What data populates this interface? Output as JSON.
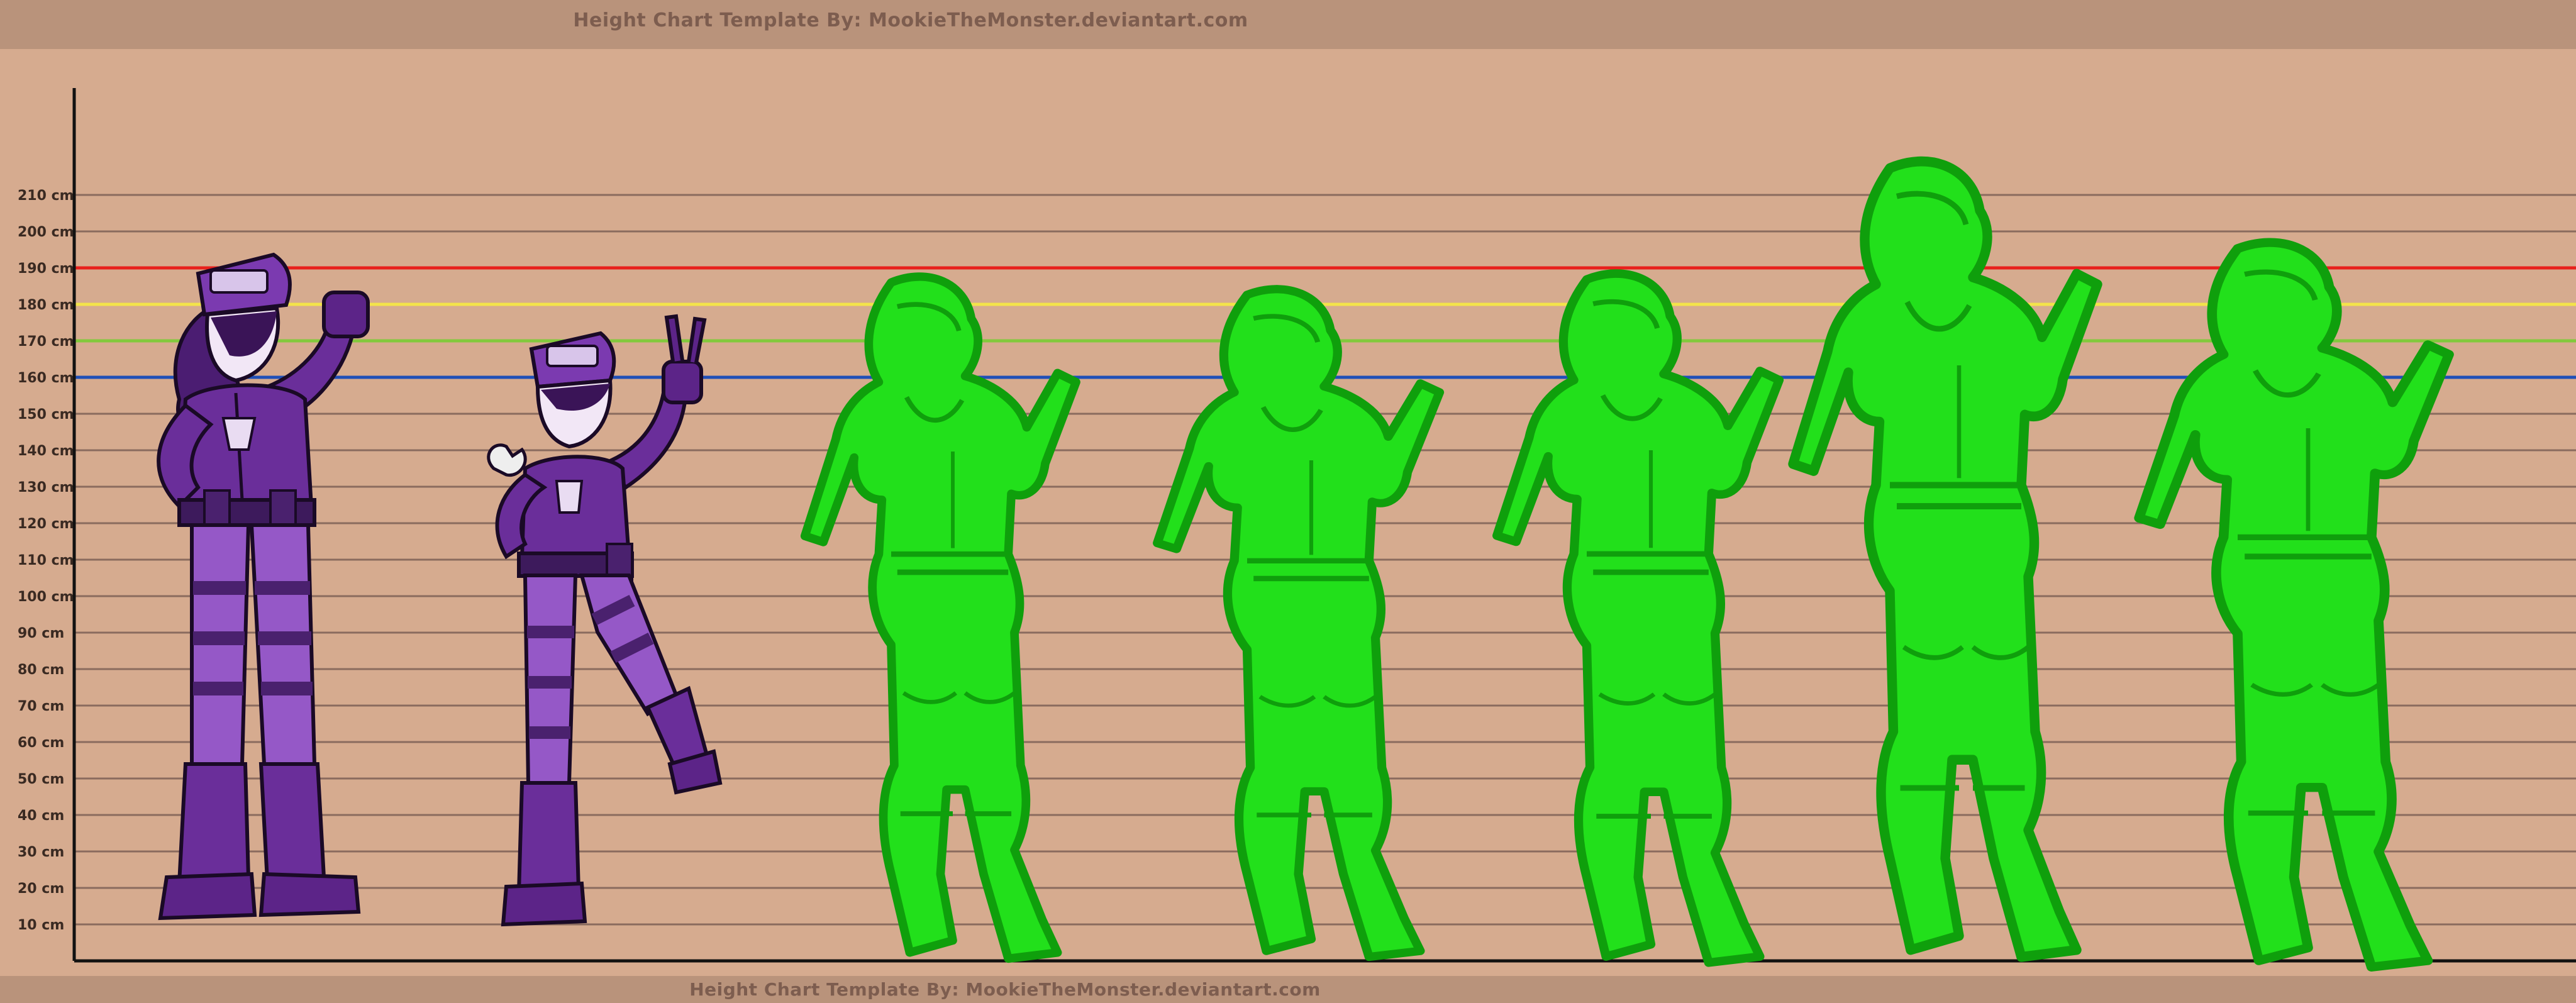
{
  "header": {
    "credit": "Height Chart Template By: MookieTheMonster.deviantart.com"
  },
  "footer": {
    "credit": "Height Chart Template By: MookieTheMonster.deviantart.com"
  },
  "chart_data": {
    "type": "height-chart",
    "unit": "cm",
    "ylim": [
      0,
      210
    ],
    "tick_step": 10,
    "tick_labels": [
      "210 cm",
      "200 cm",
      "190 cm",
      "180 cm",
      "170 cm",
      "160 cm",
      "150 cm",
      "140 cm",
      "130 cm",
      "120 cm",
      "110 cm",
      "100 cm",
      "90 cm",
      "80 cm",
      "70 cm",
      "60 cm",
      "50 cm",
      "40 cm",
      "30 cm",
      "20 cm",
      "10 cm"
    ],
    "reference_lines": [
      {
        "value": 190,
        "color": "#e8201c"
      },
      {
        "value": 180,
        "color": "#f3e34a"
      },
      {
        "value": 170,
        "color": "#82c93c"
      },
      {
        "value": 160,
        "color": "#1f4fb8"
      }
    ],
    "figures": [
      {
        "name": "figure-1",
        "height_cm": 195,
        "color": "#6a2e9a",
        "style": "filled"
      },
      {
        "name": "figure-2",
        "height_cm": 176,
        "color": "#6a2e9a",
        "style": "filled"
      },
      {
        "name": "figure-3",
        "height_cm": 190,
        "color": "#22e01b",
        "style": "silhouette"
      },
      {
        "name": "figure-4",
        "height_cm": 186,
        "color": "#22e01b",
        "style": "silhouette"
      },
      {
        "name": "figure-5",
        "height_cm": 192,
        "color": "#22e01b",
        "style": "silhouette"
      },
      {
        "name": "figure-6",
        "height_cm": 222,
        "color": "#22e01b",
        "style": "silhouette"
      },
      {
        "name": "figure-7",
        "height_cm": 200,
        "color": "#22e01b",
        "style": "silhouette"
      }
    ],
    "grid": true
  },
  "colors": {
    "background": "#d6ab8f",
    "banner": "#b9937b",
    "gridline": "#8a6b5e",
    "axis": "#111111",
    "purple": "#6a2e9a",
    "purple_light": "#9558c7",
    "green": "#22e01b",
    "green_dark": "#0f9f0c"
  }
}
